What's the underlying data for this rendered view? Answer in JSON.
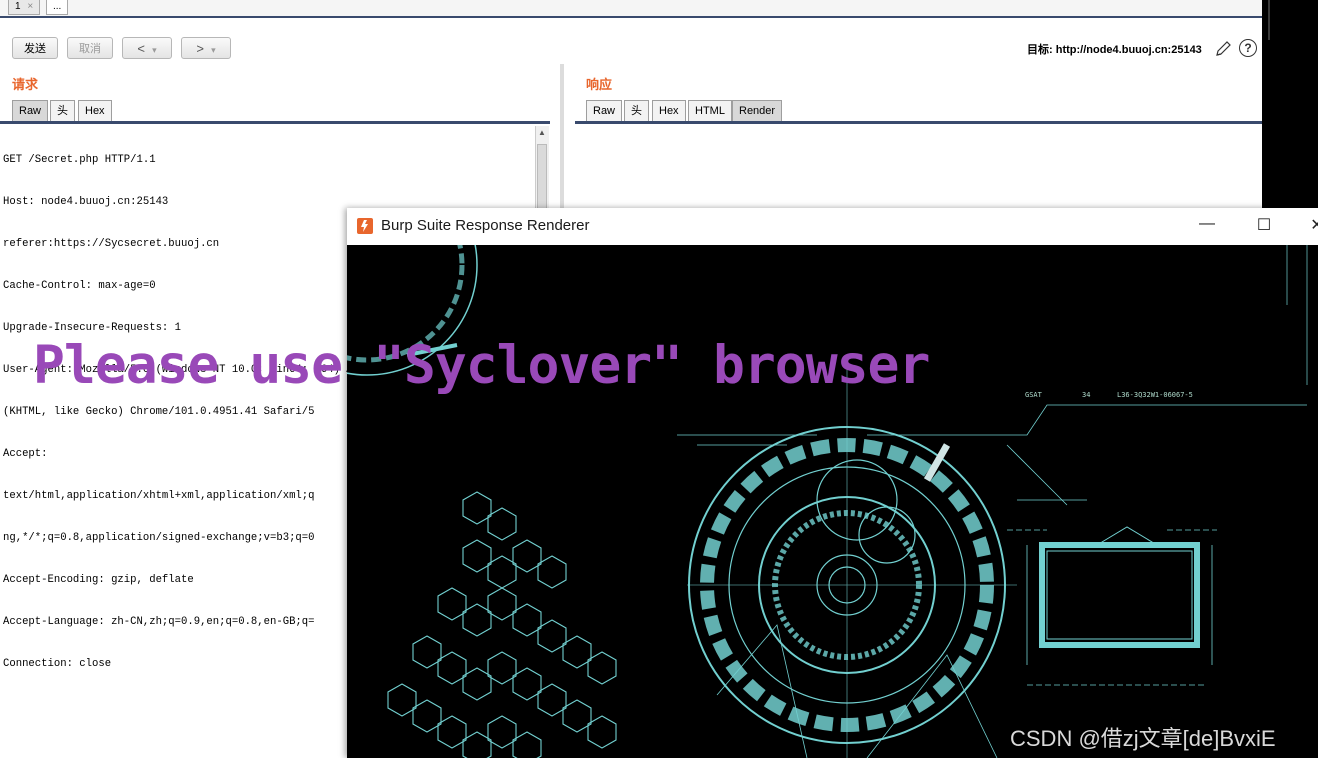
{
  "tabs": [
    {
      "label": "1",
      "close": "×"
    },
    {
      "label": "..."
    }
  ],
  "toolbar": {
    "send_label": "发送",
    "cancel_label": "取消",
    "back_label": "<",
    "forward_label": ">",
    "dropdown_glyph": "▾",
    "target_prefix": "目标:",
    "target_url": "http://node4.buuoj.cn:25143",
    "help_label": "?"
  },
  "request": {
    "title": "请求",
    "tabs": [
      "Raw",
      "头",
      "Hex"
    ],
    "active_tab": "Raw",
    "lines": [
      "GET /Secret.php HTTP/1.1",
      "Host: node4.buuoj.cn:25143",
      "referer:https://Sycsecret.buuoj.cn",
      "Cache-Control: max-age=0",
      "Upgrade-Insecure-Requests: 1",
      "User-Agent: Mozilla/5.0 (Windows NT 10.0; Win64; x64) AppleWebKit/537.36",
      "(KHTML, like Gecko) Chrome/101.0.4951.41 Safari/5",
      "Accept:",
      "text/html,application/xhtml+xml,application/xml;q",
      "ng,*/*;q=0.8,application/signed-exchange;v=b3;q=0",
      "Accept-Encoding: gzip, deflate",
      "Accept-Language: zh-CN,zh;q=0.9,en;q=0.8,en-GB;q=",
      "Connection: close"
    ]
  },
  "response": {
    "title": "响应",
    "tabs": [
      "Raw",
      "头",
      "Hex",
      "HTML",
      "Render"
    ],
    "active_tab": "Render"
  },
  "renderer": {
    "window_title": "Burp Suite Response Renderer",
    "minimize": "—",
    "maximize": "☐",
    "close": "✕",
    "message": "Please use \"Syclover\" browser",
    "hud_labels": [
      "GSAT",
      "34",
      "L36-3Q32W1-06067-5"
    ]
  },
  "watermark": "CSDN @借zj文章[de]BvxiE",
  "colors": {
    "accent_orange": "#e8662d",
    "tab_line": "#394a6d",
    "message_purple": "#9949b8",
    "hud_cyan": "#7fe8e8"
  }
}
